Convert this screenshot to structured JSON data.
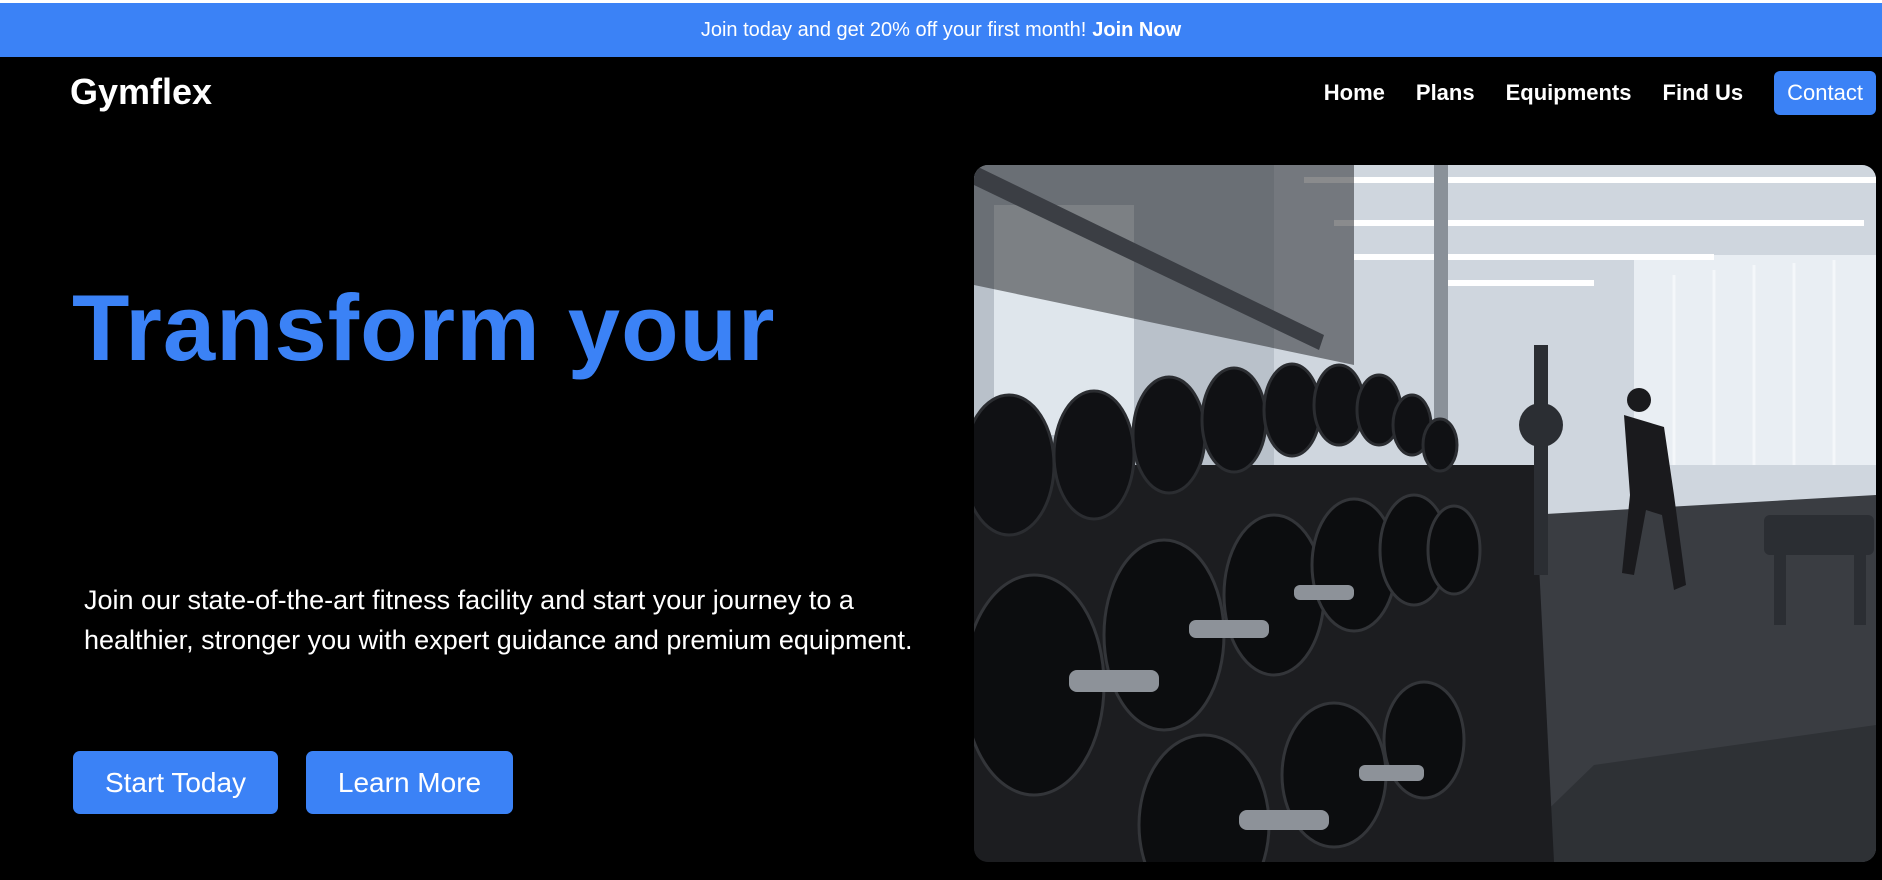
{
  "announcement": {
    "text": "Join today and get 20% off your first month!",
    "cta": "Join Now"
  },
  "brand": {
    "logo": "Gymflex"
  },
  "nav": {
    "items": [
      "Home",
      "Plans",
      "Equipments",
      "Find Us"
    ],
    "contact": "Contact"
  },
  "hero": {
    "title": "Transform your",
    "description": "Join our state-of-the-art fitness facility and start your journey to a healthier, stronger you with expert guidance and premium equipment.",
    "primary_button": "Start Today",
    "secondary_button": "Learn More"
  },
  "colors": {
    "accent": "#3b82f6",
    "background": "#000000",
    "text": "#ffffff"
  }
}
